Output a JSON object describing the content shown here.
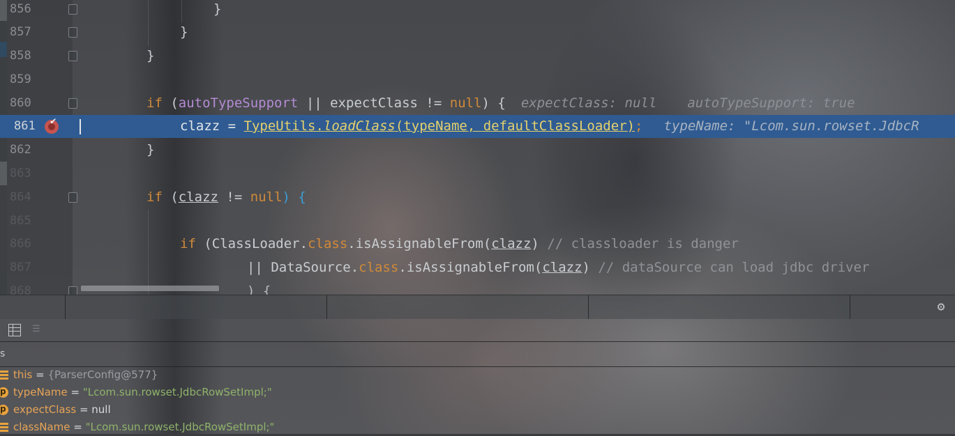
{
  "editor": {
    "lines": [
      {
        "num": "856",
        "text": "}"
      },
      {
        "num": "857",
        "text": "}"
      },
      {
        "num": "858",
        "text": "}"
      },
      {
        "num": "859",
        "text": ""
      },
      {
        "num": "860",
        "kw_if": "if",
        "open": " (",
        "var1": "autoTypeSupport",
        "op1": " || ",
        "var2": "expectClass",
        "op2": " != ",
        "nul": "null",
        "close": ") {",
        "hint1": "expectClass: null",
        "hint2": "autoTypeSupport: true"
      },
      {
        "num": "861",
        "lhs": "clazz = ",
        "cls": "TypeUtils",
        "dot": ".",
        "method": "loadClass",
        "args": "(typeName, defaultClassLoader)",
        "semi": ";",
        "hint": "typeName: \"Lcom.sun.rowset.JdbcR"
      },
      {
        "num": "862",
        "text": "}"
      },
      {
        "num": "863",
        "text": ""
      },
      {
        "num": "864",
        "kw_if": "if",
        "open": " (",
        "var": "clazz",
        "op": " != ",
        "nul": "null",
        "close": ") {"
      },
      {
        "num": "865",
        "text": ""
      },
      {
        "num": "866",
        "kw_if": "if",
        "open": " (",
        "cls": "ClassLoader",
        "dot1": ".",
        "kw_class": "class",
        "dot2": ".",
        "method": "isAssignableFrom",
        "p1": "(",
        "var": "clazz",
        "p2": ")",
        "comment": " // classloader is danger"
      },
      {
        "num": "867",
        "op": "|| ",
        "cls": "DataSource",
        "dot1": ".",
        "kw_class": "class",
        "dot2": ".",
        "method": "isAssignableFrom",
        "p1": "(",
        "var": "clazz",
        "p2": ")",
        "comment": " // dataSource can load jdbc driver"
      },
      {
        "num": "868",
        "text": ") {"
      }
    ]
  },
  "debugger": {
    "panel_label": "s",
    "variables": [
      {
        "name": "this",
        "eq": " = ",
        "value": "{ParserConfig@577}",
        "kind": "object",
        "icon": "field-icon"
      },
      {
        "name": "typeName",
        "eq": " = ",
        "value": "\"Lcom.sun.rowset.JdbcRowSetImpl;\"",
        "kind": "string",
        "icon": "parameter-icon"
      },
      {
        "name": "expectClass",
        "eq": " = ",
        "value": "null",
        "kind": "plain",
        "icon": "parameter-icon"
      },
      {
        "name": "className",
        "eq": " = ",
        "value": "\"Lcom.sun.rowset.JdbcRowSetImpl;\"",
        "kind": "string",
        "icon": "field-icon"
      }
    ]
  },
  "icons": {
    "breakpoint": "breakpoint-icon",
    "settings": "gear-icon",
    "table_view": "table-icon",
    "list_view": "list-icon"
  },
  "colors": {
    "current_line": "#2f5b92",
    "keyword": "#d08a3a",
    "breakpoint": "#c75450"
  }
}
